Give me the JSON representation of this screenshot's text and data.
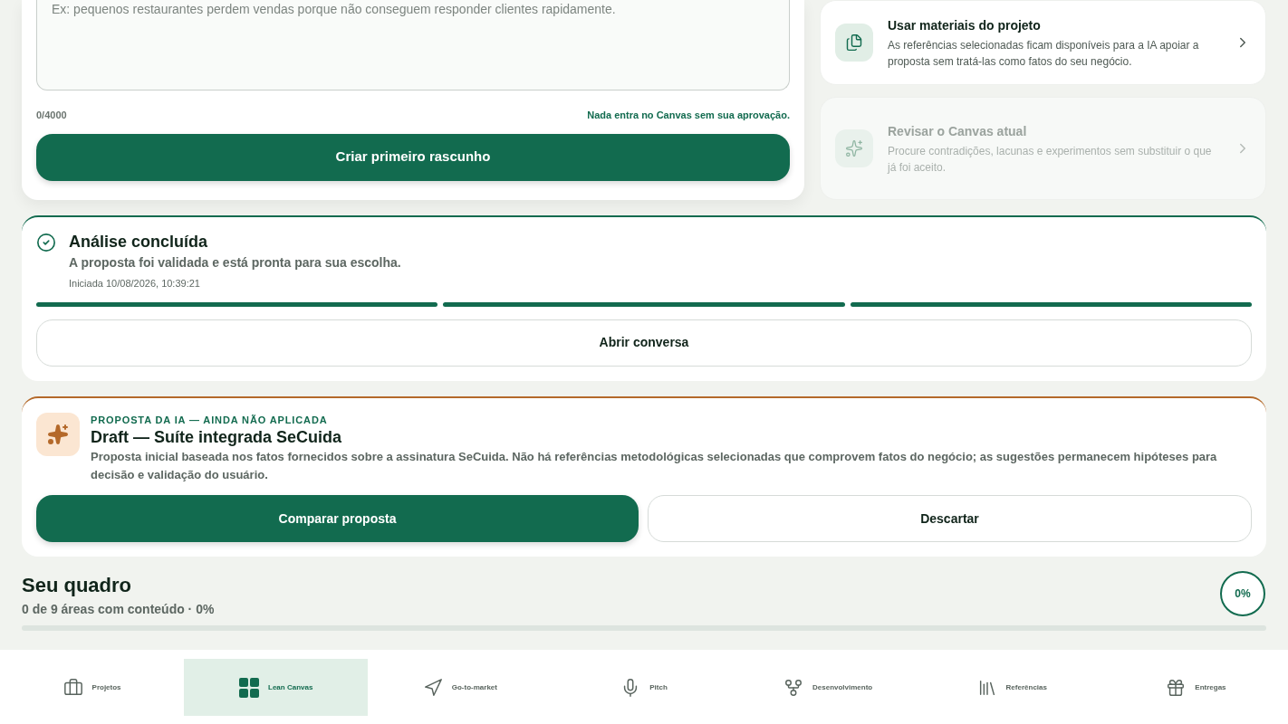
{
  "composer": {
    "placeholder": "Ex: pequenos restaurantes perdem vendas porque não conseguem responder clientes rapidamente.",
    "counter": "0/4000",
    "note": "Nada entra no Canvas sem sua aprovação.",
    "submit": "Criar primeiro rascunho"
  },
  "actions": [
    {
      "kind": "materials",
      "title": "Usar materiais do projeto",
      "description": "As referências selecionadas ficam disponíveis para a IA apoiar a proposta sem tratá-las como fatos do seu negócio.",
      "disabled": false
    },
    {
      "kind": "review",
      "title": "Revisar o Canvas atual",
      "description": "Procure contradições, lacunas e experimentos sem substituir o que já foi aceito.",
      "disabled": true
    }
  ],
  "analysis": {
    "title": "Análise concluída",
    "subtitle": "A proposta foi validada e está pronta para sua escolha.",
    "started": "Iniciada 10/08/2026, 10:39:21",
    "steps": [
      {
        "done": true
      },
      {
        "done": true
      },
      {
        "done": true
      }
    ],
    "button": "Abrir conversa"
  },
  "proposal": {
    "eyebrow": "PROPOSTA DA IA — AINDA NÃO APLICADA",
    "title": "Draft — Suíte integrada SeCuida",
    "description": "Proposta inicial baseada nos fatos fornecidos sobre a assinatura SeCuida. Não há referências metodológicas selecionadas que comprovem fatos do negócio; as sugestões permanecem hipóteses para decisão e validação do usuário.",
    "primary": "Comparar proposta",
    "secondary": "Descartar"
  },
  "board": {
    "title": "Seu quadro",
    "summary": "0 de 9 áreas com conteúdo · 0%",
    "percent": "0%",
    "level": 0
  },
  "nav": [
    {
      "kind": "projects",
      "label": "Projetos",
      "selected": false
    },
    {
      "kind": "canvas",
      "label": "Lean Canvas",
      "selected": true
    },
    {
      "kind": "gtm",
      "label": "Go-to-market",
      "selected": false
    },
    {
      "kind": "pitch",
      "label": "Pitch",
      "selected": false
    },
    {
      "kind": "dev",
      "label": "Desenvolvimento",
      "selected": false
    },
    {
      "kind": "refs",
      "label": "Referências",
      "selected": false
    },
    {
      "kind": "deliver",
      "label": "Entregas",
      "selected": false
    }
  ]
}
